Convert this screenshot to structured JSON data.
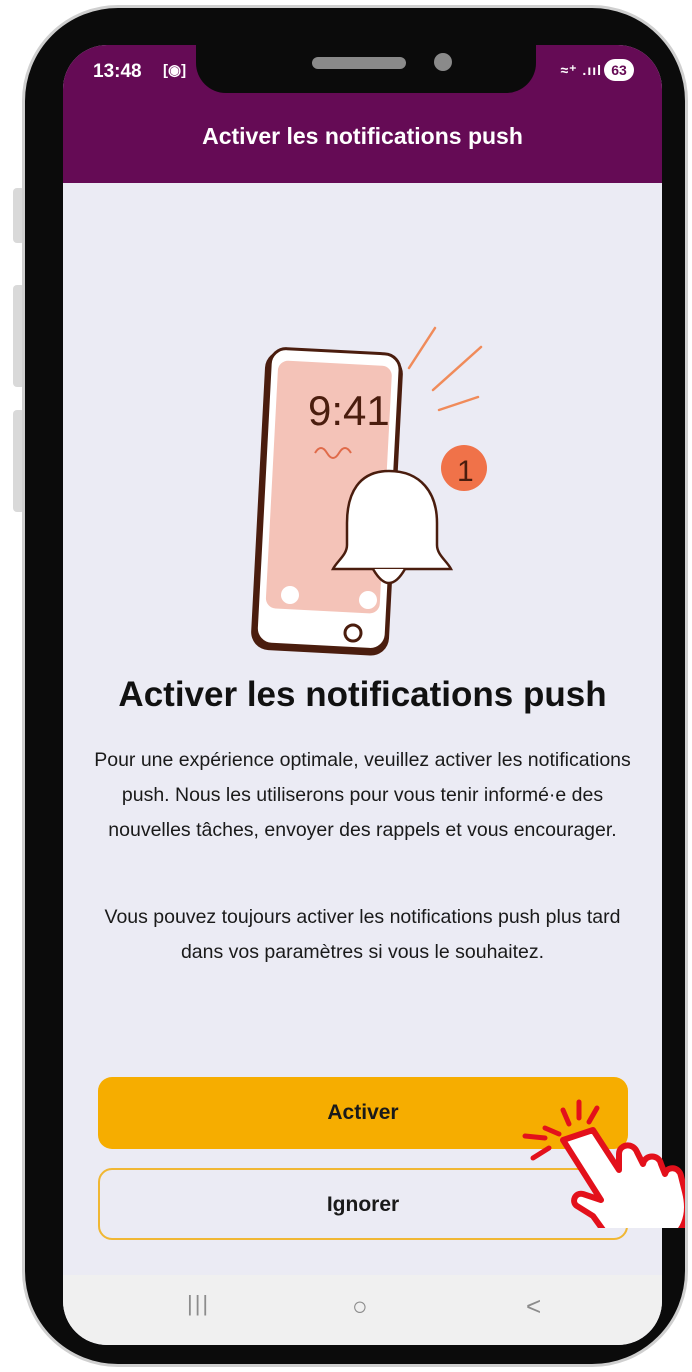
{
  "status_bar": {
    "time": "13:48",
    "record_icon": "screen-record-icon",
    "signal_text": "≈⁺ .ııl",
    "battery": "63"
  },
  "app_bar": {
    "title": "Activer les notifications push"
  },
  "illustration": {
    "clock_text": "9:41",
    "badge_count": "1"
  },
  "content": {
    "heading": "Activer les notifications push",
    "paragraph1": "Pour une expérience optimale, veuillez activer les notifications push. Nous les utiliserons pour vous tenir informé·e des nouvelles tâches, envoyer des rappels et vous encourager.",
    "paragraph2": "Vous pouvez toujours activer les notifications push plus tard dans vos paramètres si vous le souhaitez."
  },
  "buttons": {
    "primary": "Activer",
    "secondary": "Ignorer"
  },
  "nav": {
    "recents": "|||",
    "home": "○",
    "back": "<"
  },
  "colors": {
    "brand": "#650b55",
    "accent": "#f6ad00",
    "background": "#ebebf4",
    "tap_indicator": "#e3101b"
  }
}
